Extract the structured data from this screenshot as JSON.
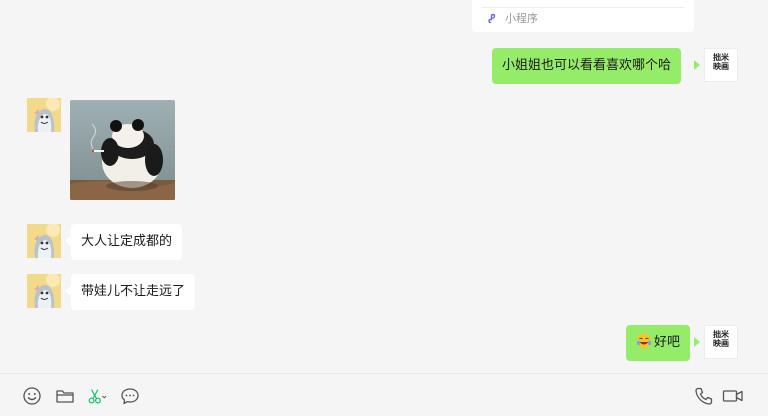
{
  "mini_program_card": {
    "label": "小程序",
    "icon": "mini-program-link-icon"
  },
  "messages": [
    {
      "id": "m1",
      "sender": "self",
      "type": "text",
      "text": "小姐姐也可以看看喜欢哪个哈"
    },
    {
      "id": "m2",
      "sender": "other",
      "type": "image",
      "image": "panda-sticker"
    },
    {
      "id": "m3",
      "sender": "other",
      "type": "text",
      "text": "大人让定成都的"
    },
    {
      "id": "m4",
      "sender": "other",
      "type": "text",
      "text": "带娃儿不让走远了"
    },
    {
      "id": "m5",
      "sender": "self",
      "type": "text",
      "emoji": "laughing-emoji",
      "text": "好吧"
    }
  ],
  "self_avatar": {
    "logo_line1": "拙米",
    "logo_line2": "映画"
  },
  "toolbar": {
    "left_icons": [
      "emoji-icon",
      "folder-icon",
      "scissors-icon",
      "chat-history-icon"
    ],
    "right_icons": [
      "phone-icon",
      "video-call-icon"
    ]
  },
  "colors": {
    "self_bubble": "#95ec69",
    "other_bubble": "#ffffff",
    "background": "#f5f5f5",
    "accent": "#07c160"
  }
}
